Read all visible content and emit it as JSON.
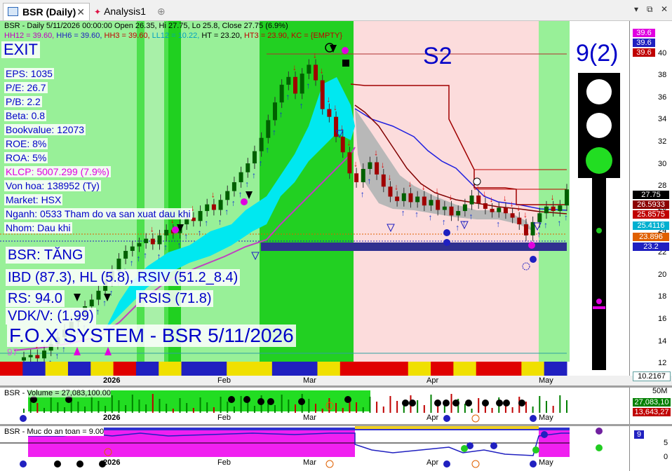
{
  "tabs": [
    {
      "label": "BSR (Daily)",
      "active": true
    },
    {
      "label": "Analysis1",
      "active": false
    }
  ],
  "header": {
    "line1": "BSR - Daily 5/11/2026 00:00:00 Open 26.35, Hi 27.75, Lo 25.8, Close 27.75 (6.9%)",
    "hh12": "HH12 = 39.60,",
    "hh6": " HH6 = 39.60,",
    "hh3": " HH3 = 39.60,",
    "ll12": " LL12 = 10.22,",
    "ht": " HT  = 23.20,",
    "ht3": " HT3  = 23.90,",
    "kc": " KC = {EMPTY}"
  },
  "labels": {
    "exit": "EXIT",
    "s2": "S2",
    "signal_count": "9(2)",
    "status": "BSR: TĂNG",
    "ibd": "IBD (87.3), HL (5.8), RSIV (51.2_8.4)",
    "rs": "RS: 94.0",
    "rsis": "RSIS (71.8)",
    "vdk": "VDK/V:  (1.99)",
    "system": "F.O.X SYSTEM - BSR 5/11/2026",
    "side_value": "97"
  },
  "fundamentals": [
    {
      "text": "EPS: 1035",
      "color": "#0000c8"
    },
    {
      "text": "P/E: 26.7",
      "color": "#0000c8"
    },
    {
      "text": "P/B: 2.2",
      "color": "#0000c8"
    },
    {
      "text": "Beta: 0.8",
      "color": "#0000c8"
    },
    {
      "text": "Bookvalue: 12073",
      "color": "#0000c8"
    },
    {
      "text": "ROE: 8%",
      "color": "#0000c8"
    },
    {
      "text": "ROA: 5%",
      "color": "#0000c8"
    },
    {
      "text": "KLCP: 5007.299 (7.9%)",
      "color": "#e000e0"
    },
    {
      "text": "Von hoa: 138952 (Ty)",
      "color": "#0000c8"
    },
    {
      "text": "Market: HSX",
      "color": "#0000c8"
    },
    {
      "text": "Nganh: 0533 Tham do va san xuat dau khi",
      "color": "#0000c8"
    },
    {
      "text": "Nhom: Dau khi",
      "color": "#0000c8"
    }
  ],
  "price_axis": {
    "ticks": [
      "40",
      "38",
      "36",
      "34",
      "32",
      "30",
      "28",
      "26",
      "24",
      "22",
      "20",
      "18",
      "16",
      "14",
      "12"
    ],
    "top_tags": [
      {
        "text": "39.6",
        "color": "#e000e0"
      },
      {
        "text": "39.6",
        "color": "#2020c0"
      },
      {
        "text": "39.6",
        "color": "#c00000"
      }
    ],
    "tags": [
      {
        "text": "27.75",
        "color": "#000000"
      },
      {
        "text": "26.5933",
        "color": "#8b0000"
      },
      {
        "text": "25.8575",
        "color": "#c00000"
      },
      {
        "text": "25.4116",
        "color": "#00b0d0"
      },
      {
        "text": "23.896",
        "color": "#e06000"
      },
      {
        "text": "23.2",
        "color": "#2020c0"
      },
      {
        "text": "10.2167",
        "color": "#00a0a0"
      }
    ]
  },
  "months": [
    "2026",
    "Feb",
    "Mar",
    "Apr",
    "May"
  ],
  "volume_pane": {
    "title": "BSR - Volume = 27,083,100.00",
    "axis_top": "50M",
    "tags": [
      {
        "text": "27,083,10",
        "color": "#008000"
      },
      {
        "text": "13,643,27",
        "color": "#c00000"
      }
    ]
  },
  "safety_pane": {
    "title": "BSR - Muc do an toan = 9.00",
    "ticks": [
      "5",
      "0"
    ],
    "tag": "9"
  },
  "chart_data": {
    "type": "candlestick",
    "title": "BSR - Daily",
    "x": [
      "Jan",
      "Jan",
      "Jan",
      "Jan",
      "Jan",
      "Jan",
      "Jan",
      "Jan",
      "Jan",
      "Jan",
      "Jan",
      "Jan",
      "Jan",
      "Jan",
      "Jan",
      "Jan",
      "Jan",
      "Jan",
      "Feb",
      "Feb",
      "Feb",
      "Feb",
      "Feb",
      "Feb",
      "Feb",
      "Feb",
      "Feb",
      "Feb",
      "Feb",
      "Feb",
      "Feb",
      "Feb",
      "Feb",
      "Feb",
      "Feb",
      "Mar",
      "Mar",
      "Mar",
      "Mar",
      "Mar",
      "Mar",
      "Mar",
      "Mar",
      "Mar",
      "Mar",
      "Mar",
      "Mar",
      "Mar",
      "Mar",
      "Mar",
      "Mar",
      "Mar",
      "Mar",
      "Mar",
      "Mar",
      "Mar",
      "Apr",
      "Apr",
      "Apr",
      "Apr",
      "Apr",
      "Apr",
      "Apr",
      "Apr",
      "Apr",
      "Apr",
      "Apr",
      "Apr",
      "Apr",
      "Apr",
      "Apr",
      "Apr",
      "Apr",
      "Apr",
      "May",
      "May",
      "May",
      "May",
      "May",
      "May",
      "May"
    ],
    "close": [
      12.6,
      12.8,
      12.5,
      13.2,
      13.8,
      14.4,
      15.1,
      15.8,
      16.4,
      17.2,
      17.8,
      18.6,
      19.5,
      20.4,
      21.5,
      22.2,
      22.6,
      22.9,
      23.3,
      22.8,
      23.6,
      24.1,
      23.8,
      24.6,
      25.2,
      24.9,
      25.8,
      26.4,
      25.9,
      26.8,
      27.6,
      28.4,
      29.3,
      30.1,
      31.2,
      32.4,
      34.0,
      35.6,
      37.2,
      37.9,
      36.4,
      38.2,
      39.0,
      37.6,
      35.0,
      34.3,
      32.5,
      31.1,
      29.2,
      28.4,
      29.6,
      30.2,
      29.1,
      28.0,
      27.1,
      26.7,
      27.4,
      26.6,
      27.1,
      26.3,
      26.8,
      25.9,
      26.2,
      25.4,
      25.8,
      26.4,
      27.2,
      26.5,
      26.0,
      25.7,
      26.1,
      25.6,
      25.2,
      24.6,
      23.6,
      24.8,
      25.6,
      26.2,
      25.8,
      26.3,
      27.75
    ],
    "ylim": [
      11,
      42
    ],
    "lines": [
      "HH12 = 39.60",
      "HH6 = 39.60",
      "HH3 = 39.60",
      "LL12 = 10.22",
      "HT = 23.20",
      "HT3 = 23.90"
    ],
    "last_close": 27.75,
    "volume_last": 27083100,
    "safety_last": 9
  }
}
